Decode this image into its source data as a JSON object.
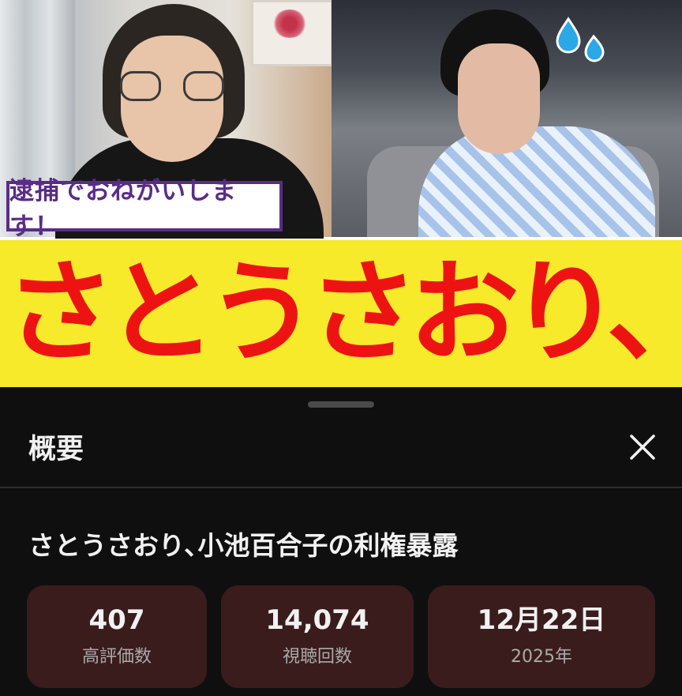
{
  "thumbnail": {
    "caption": "逮捕でおねがいします！",
    "headline": "さとうさおり、暴露"
  },
  "sheet": {
    "title": "概要",
    "close_icon": "close-icon",
    "video_title": "さとうさおり､小池百合子の利権暴露",
    "stats": [
      {
        "value": "407",
        "label": "高評価数"
      },
      {
        "value": "14,074",
        "label": "視聴回数"
      },
      {
        "value": "12月22日",
        "label": "2025年"
      }
    ]
  },
  "colors": {
    "accent_red": "#ee1313",
    "band_yellow": "#f6ea2a",
    "caption_purple": "#5a2c88",
    "stat_bg": "#3a1c1d",
    "sheet_bg": "#0f0f0f"
  }
}
